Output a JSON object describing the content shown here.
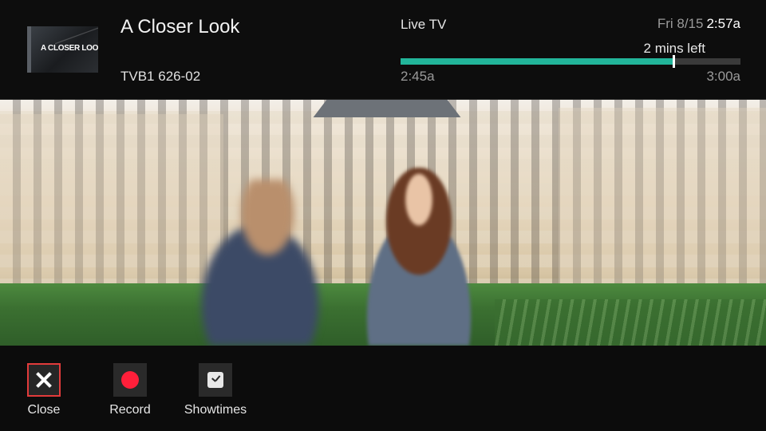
{
  "program": {
    "title": "A Closer Look",
    "thumbnail_text": "A CLOSER LOOK",
    "channel": "TVB1 626-02"
  },
  "status": {
    "mode": "Live TV",
    "date": "Fri 8/15",
    "current_time": "2:57a",
    "remaining": "2 mins left",
    "start_time": "2:45a",
    "end_time": "3:00a",
    "progress_fraction": 0.8,
    "progress_color": "#22b59a"
  },
  "actions": [
    {
      "label": "Close",
      "icon": "close-icon"
    },
    {
      "label": "Record",
      "icon": "record-icon"
    },
    {
      "label": "Showtimes",
      "icon": "clock-icon"
    }
  ],
  "colors": {
    "focus_border": "#e23b3b",
    "record_red": "#ff1f3a"
  }
}
